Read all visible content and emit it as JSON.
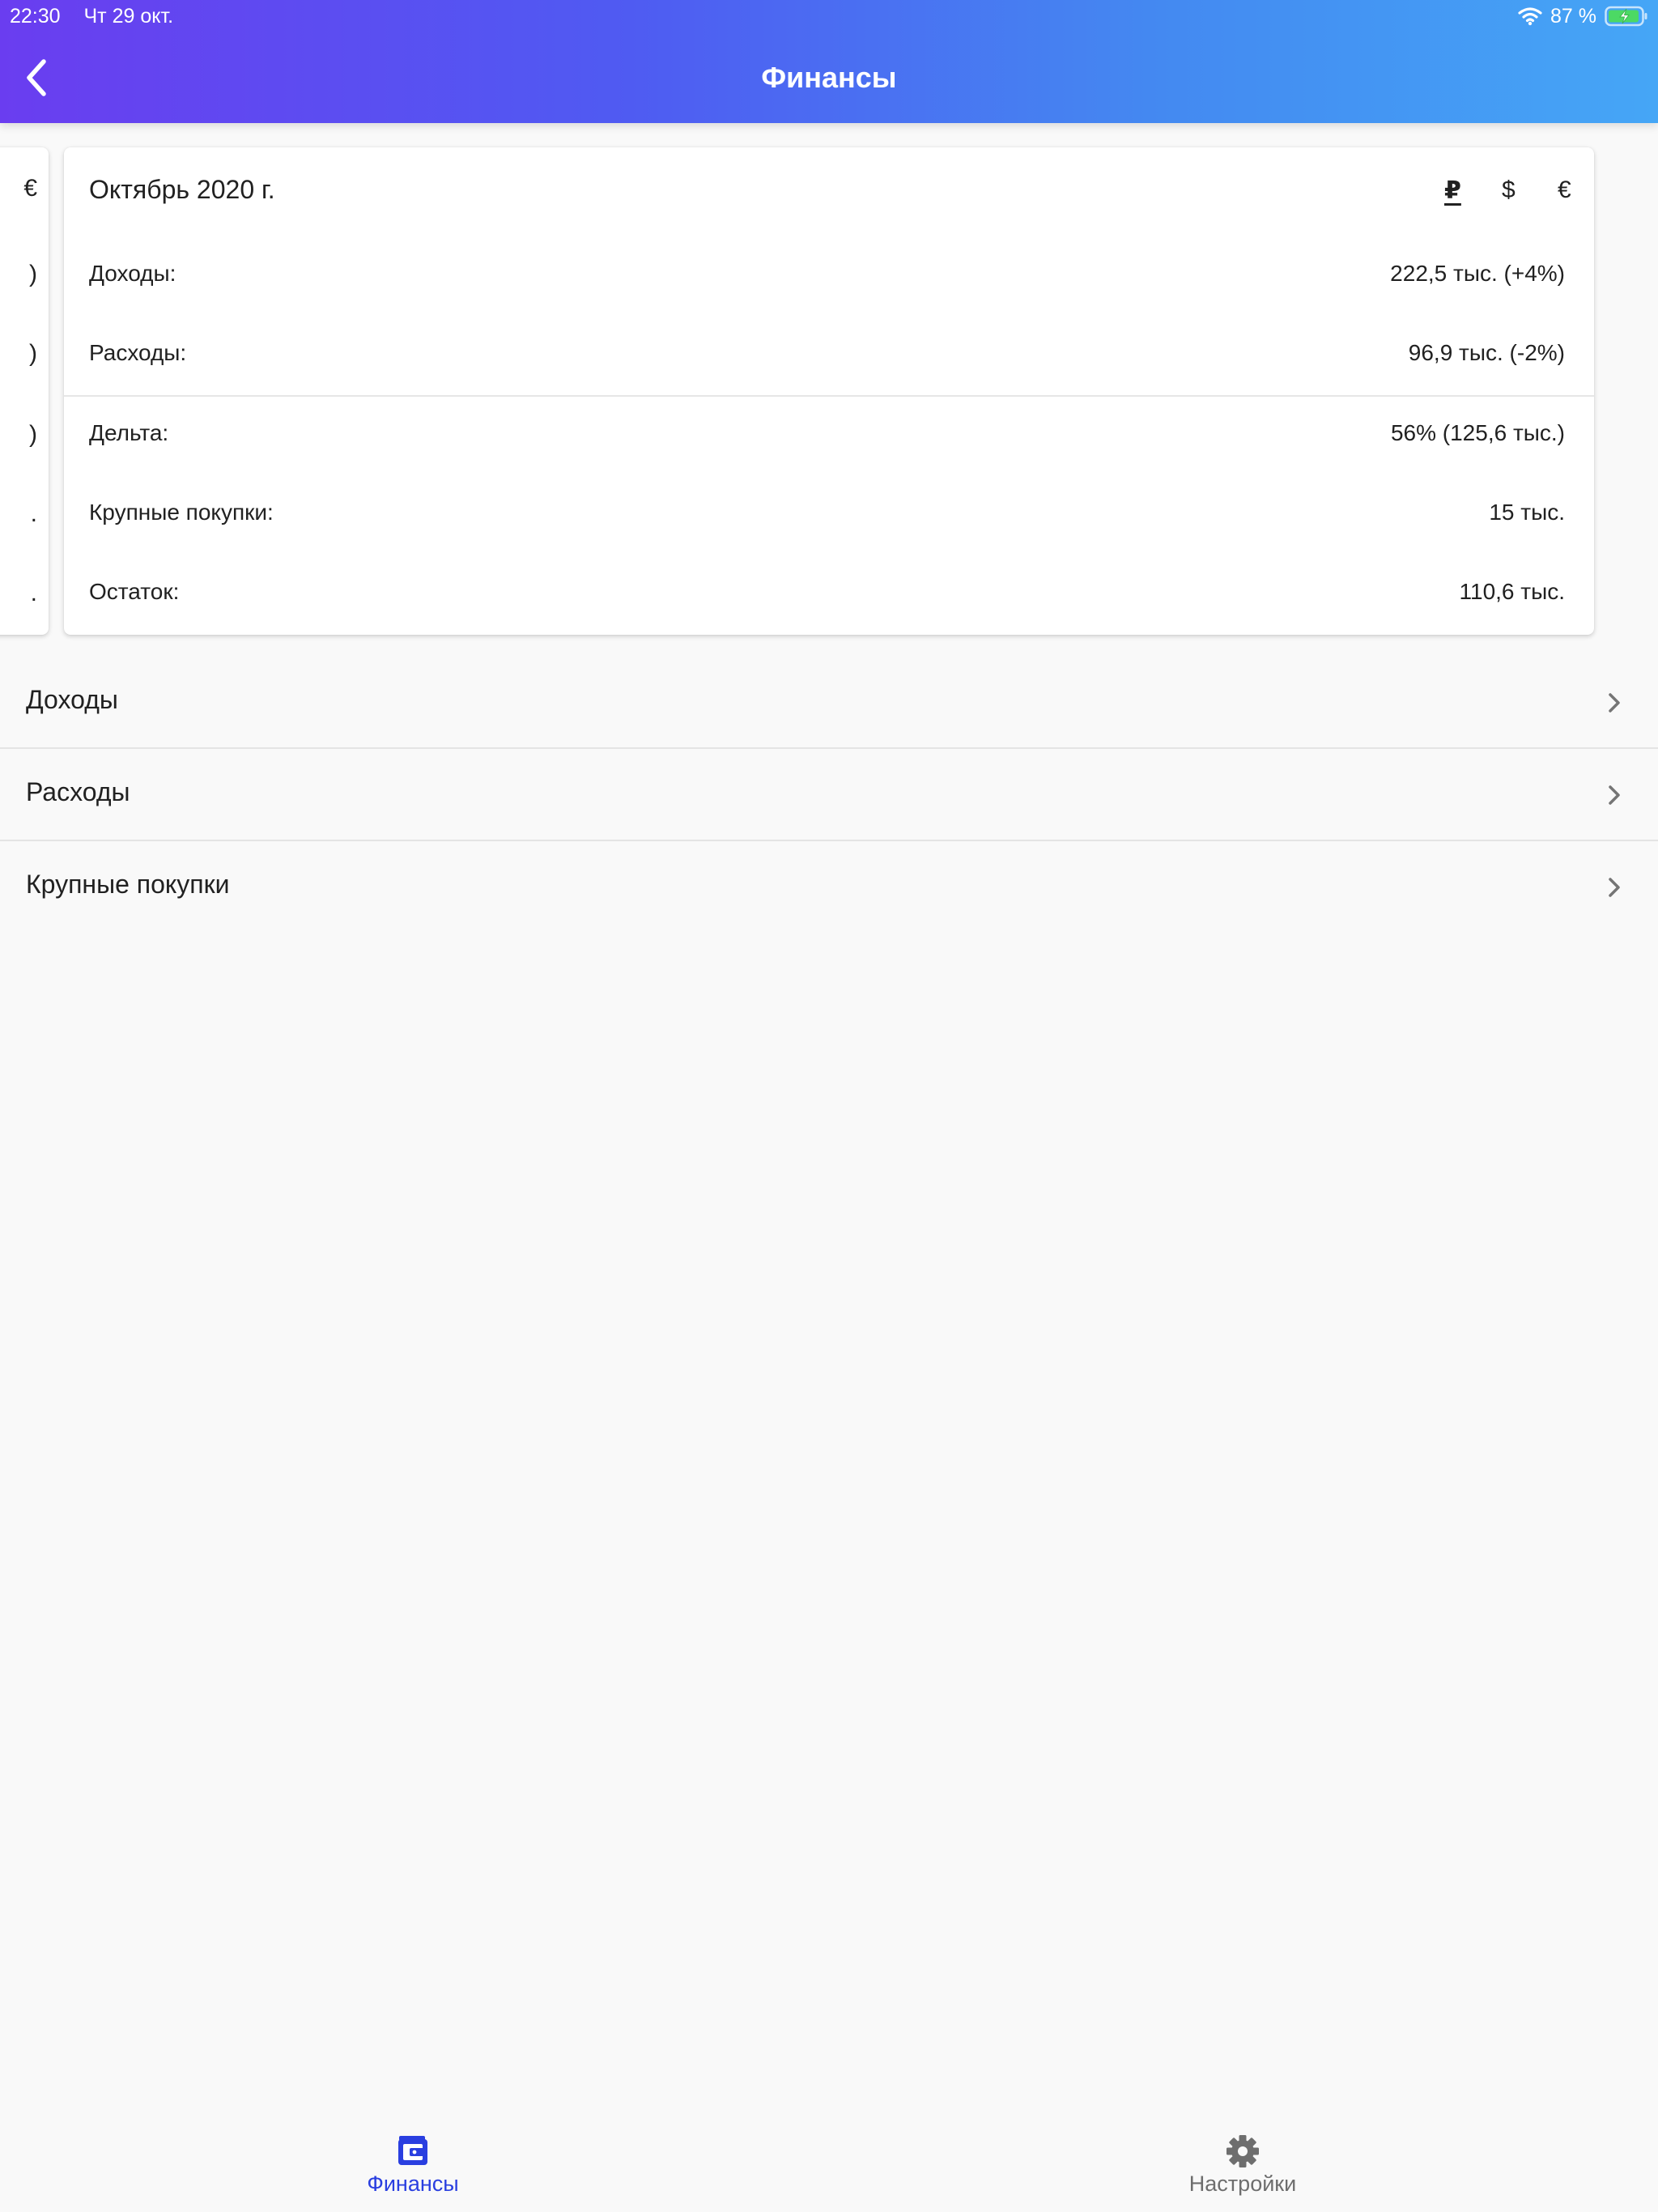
{
  "status_bar": {
    "time": "22:30",
    "date": "Чт 29 окт.",
    "battery": "87 %"
  },
  "header": {
    "title": "Финансы"
  },
  "peek_card": {
    "glyphs": [
      "€",
      ")",
      ")",
      ")",
      ".",
      "."
    ]
  },
  "summary": {
    "period": "Октябрь 2020 г.",
    "currencies": [
      "₽",
      "$",
      "€"
    ],
    "selected_currency": "₽",
    "rows": [
      {
        "label": "Доходы:",
        "value": "222,5 тыс. (+4%)"
      },
      {
        "label": "Расходы:",
        "value": "96,9 тыс. (-2%)"
      },
      {
        "label": "Дельта:",
        "value": "56% (125,6 тыс.)"
      },
      {
        "label": "Крупные покупки:",
        "value": "15 тыс."
      },
      {
        "label": "Остаток:",
        "value": "110,6 тыс."
      }
    ]
  },
  "menu": [
    {
      "label": "Доходы"
    },
    {
      "label": "Расходы"
    },
    {
      "label": "Крупные покупки"
    }
  ],
  "bottom_nav": {
    "finance": {
      "label": "Финансы",
      "icon": "wallet-icon"
    },
    "settings": {
      "label": "Настройки",
      "icon": "gear-icon"
    }
  },
  "colors": {
    "gradient_start": "#6a3df0",
    "gradient_end": "#45a6f6",
    "active_tab": "#2a3fe0",
    "inactive_tab": "#6e6e6e",
    "background": "#f9f9f9"
  }
}
